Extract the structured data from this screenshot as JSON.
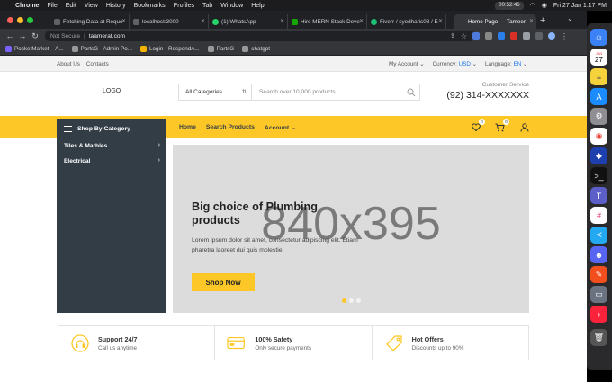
{
  "menubar": {
    "app": "Chrome",
    "items": [
      "File",
      "Edit",
      "View",
      "History",
      "Bookmarks",
      "Profiles",
      "Tab",
      "Window",
      "Help"
    ],
    "timer": "00:52:46",
    "datetime": "Fri 27 Jan  1:17 PM"
  },
  "tabs": [
    {
      "title": "Fetching Data at Reque",
      "color": "#5f6368"
    },
    {
      "title": "localhost:3000",
      "color": "#5f6368"
    },
    {
      "title": "(1) WhatsApp",
      "color": "#25d366"
    },
    {
      "title": "Hire MERN Stack Deve",
      "color": "#14a800"
    },
    {
      "title": "Fiverr / syedharis08 / E",
      "color": "#1dbf73"
    },
    {
      "title": "Home Page — Tameer",
      "color": "#5f6368",
      "active": true
    }
  ],
  "address": {
    "security": "Not Secure",
    "url": "taamerat.com"
  },
  "bookmarks": [
    "PocketMarket – A...",
    "PartsG - Admin Po...",
    "Login - RespondA...",
    "PartsG",
    "chatgpt"
  ],
  "site": {
    "topbar": {
      "about": "About Us",
      "contacts": "Contacts",
      "my_account": "My Account",
      "currency_label": "Currency:",
      "currency_value": "USD",
      "language_label": "Language:",
      "language_value": "EN"
    },
    "logo": "LOGO",
    "search": {
      "category": "All Categories",
      "placeholder": "Search over 10,000 products"
    },
    "customer_service": {
      "label": "Customer Service",
      "phone": "(92) 314-XXXXXXX"
    },
    "shop_by_category": "Shop By Category",
    "menu": {
      "home": "Home",
      "search_products": "Search Products",
      "account": "Account"
    },
    "wishlist_count": "0",
    "cart_count": "0",
    "categories": [
      "Tiles & Marbles",
      "Electrical"
    ],
    "hero": {
      "placeholder": "840x395",
      "title": "Big choice of Plumbing products",
      "description": "Lorem ipsum dolor sit amet, consectetur adipiscing elit. Etiam pharetra laoreet dui quis molestie.",
      "button": "Shop Now"
    },
    "features": [
      {
        "title": "Support 24/7",
        "subtitle": "Call us anytime",
        "icon": "support-icon"
      },
      {
        "title": "100% Safety",
        "subtitle": "Only secure payments",
        "icon": "card-icon"
      },
      {
        "title": "Hot Offers",
        "subtitle": "Discounts up to 90%",
        "icon": "tag-icon"
      }
    ]
  },
  "dock": {
    "calendar_month": "JAN",
    "calendar_day": "27"
  },
  "colors": {
    "accent": "#fdc827",
    "sidebar": "#333d46"
  }
}
